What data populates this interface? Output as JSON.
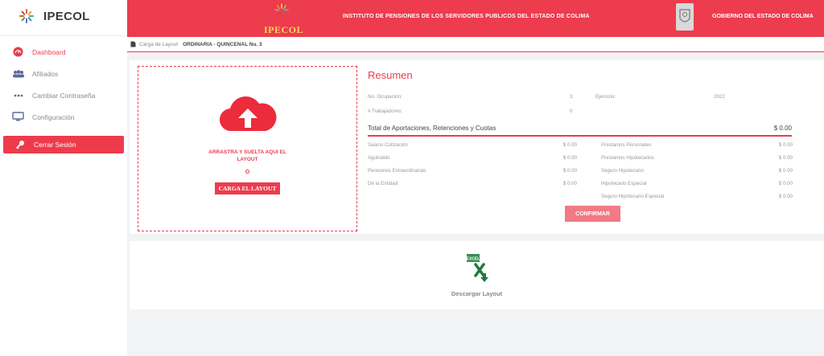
{
  "brand": {
    "name": "IPECOL"
  },
  "colors": {
    "accent": "#ec3c4d",
    "accent_light": "#f07a85",
    "excel": "#1f7a3d"
  },
  "sidebar": {
    "items": [
      {
        "label": "Dashboard",
        "icon": "dashboard-icon"
      },
      {
        "label": "Afiliados",
        "icon": "users-icon"
      },
      {
        "label": "Cambiar Contraseña",
        "icon": "password-icon"
      },
      {
        "label": "Configuración",
        "icon": "monitor-icon"
      }
    ],
    "logout": {
      "label": "Cerrar Sesión",
      "icon": "key-icon"
    }
  },
  "header": {
    "logo_text": "IPECOL",
    "title": "INSTITUTO DE PENSIONES DE LOS SERVIDORES PUBLICOS DEL ESTADO DE COLIMA",
    "government": "GOBIERNO DEL ESTADO DE COLIMA"
  },
  "breadcrumb": {
    "parent": "Carga de Layout",
    "current": "ORDINARIA - QUINCENAL Nu. 3"
  },
  "upload": {
    "drop_text": "ARRASTRA Y SUELTA AQUI EL LAYOUT",
    "or": "O",
    "button": "CARGA EL LAYOUT"
  },
  "summary": {
    "title": "Resumen",
    "no_ocupacion_label": "No. Ocupación:",
    "no_ocupacion_value": "3",
    "ejercicio_label": "Ejercicio:",
    "ejercicio_value": "2022",
    "trabajadores_label": "# Trabajadores:",
    "trabajadores_value": "0",
    "total_label": "Total de Aportaciones, Retenciones y Cuotas",
    "total_value": "$ 0.00",
    "left_rows": [
      {
        "label": "Salario Cotización",
        "value": "$ 0.00"
      },
      {
        "label": "Aguinaldo",
        "value": "$ 0.00"
      },
      {
        "label": "Pensiones Extraordinarias",
        "value": "$ 0.00"
      },
      {
        "label": "De la Entidad",
        "value": "$ 0.00"
      }
    ],
    "right_rows": [
      {
        "label": "Prestamos Personales",
        "value": "$ 0.00"
      },
      {
        "label": "Prestamos Hipotecarios",
        "value": "$ 0.00"
      },
      {
        "label": "Seguro Hipotecario",
        "value": "$ 0.00"
      },
      {
        "label": "Hipotecario Especial",
        "value": "$ 0.00"
      },
      {
        "label": "Seguro Hipotecario Especial",
        "value": "$ 0.00"
      }
    ],
    "confirm": "CONFIRMAR"
  },
  "download": {
    "label": "Descargar Layout",
    "icon_text": "EXCEL"
  }
}
